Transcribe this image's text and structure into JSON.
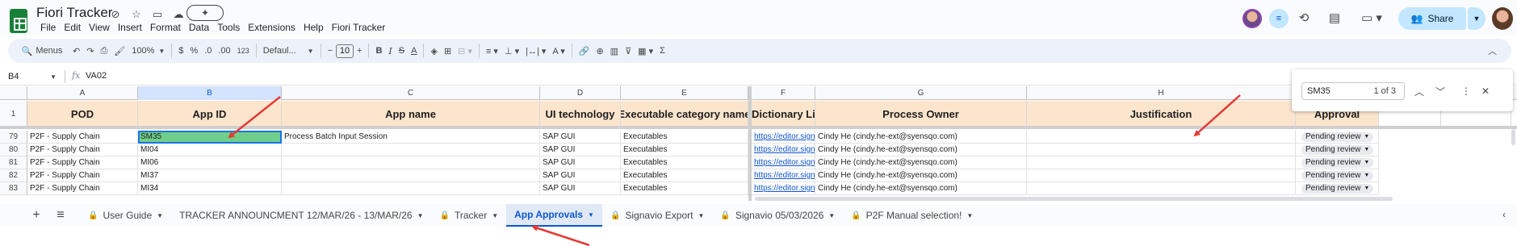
{
  "title_bar": {
    "doc_title": "Fiori Tracker",
    "menu": [
      "File",
      "Edit",
      "View",
      "Insert",
      "Format",
      "Data",
      "Tools",
      "Extensions",
      "Help",
      "Fiori Tracker"
    ],
    "share_label": "Share"
  },
  "toolbar": {
    "menus_label": "Menus",
    "zoom": "100%",
    "currency": "$",
    "percent": "%",
    "dec_decrease": ".0",
    "dec_increase": ".00",
    "number_format": "123",
    "font": "Defaul...",
    "font_size": "10"
  },
  "formula_bar": {
    "cell_ref": "B4",
    "fx": "fx",
    "value": "VA02"
  },
  "find": {
    "query": "SM35",
    "count": "1 of 3"
  },
  "grid": {
    "columns": [
      "A",
      "B",
      "C",
      "D",
      "E",
      "F",
      "G",
      "H",
      "I",
      "",
      ""
    ],
    "header_row_number": "1",
    "headers": [
      "POD",
      "App ID",
      "App name",
      "UI technology",
      "Executable category name",
      "Dictionary Link",
      "Process Owner",
      "Justification",
      "Approval"
    ],
    "rows": [
      {
        "num": "79",
        "pod": "P2F - Supply Chain",
        "app_id": "SM35",
        "app_name": "Process Batch Input Session",
        "ui": "SAP GUI",
        "category": "Executables",
        "link": "https://editor.signavio.com",
        "owner": "Cindy He (cindy.he-ext@syensqo.com)",
        "justification": "",
        "approval": "Pending review"
      },
      {
        "num": "80",
        "pod": "P2F - Supply Chain",
        "app_id": "MI04",
        "app_name": "",
        "ui": "SAP GUI",
        "category": "Executables",
        "link": "https://editor.signavio.com",
        "owner": "Cindy He (cindy.he-ext@syensqo.com)",
        "justification": "",
        "approval": "Pending review"
      },
      {
        "num": "81",
        "pod": "P2F - Supply Chain",
        "app_id": "MI06",
        "app_name": "",
        "ui": "SAP GUI",
        "category": "Executables",
        "link": "https://editor.signavio.com",
        "owner": "Cindy He (cindy.he-ext@syensqo.com)",
        "justification": "",
        "approval": "Pending review"
      },
      {
        "num": "82",
        "pod": "P2F - Supply Chain",
        "app_id": "MI37",
        "app_name": "",
        "ui": "SAP GUI",
        "category": "Executables",
        "link": "https://editor.signavio.com",
        "owner": "Cindy He (cindy.he-ext@syensqo.com)",
        "justification": "",
        "approval": "Pending review"
      },
      {
        "num": "83",
        "pod": "P2F - Supply Chain",
        "app_id": "MI34",
        "app_name": "",
        "ui": "SAP GUI",
        "category": "Executables",
        "link": "https://editor.signavio.com",
        "owner": "Cindy He (cindy.he-ext@syensqo.com)",
        "justification": "",
        "approval": "Pending review"
      }
    ]
  },
  "sheet_tabs": [
    {
      "label": "User Guide",
      "locked": true
    },
    {
      "label": "TRACKER ANNOUNCMENT 12/MAR/26 - 13/MAR/26",
      "locked": false
    },
    {
      "label": "Tracker",
      "locked": true
    },
    {
      "label": "App Approvals",
      "locked": false,
      "active": true
    },
    {
      "label": "Signavio Export",
      "locked": true
    },
    {
      "label": "Signavio 05/03/2026",
      "locked": true
    },
    {
      "label": "P2F Manual selection!",
      "locked": true
    }
  ],
  "colors": {
    "header_fill": "#fce5cd",
    "active_cell_fill": "#6fcf8a",
    "accent": "#0b57d0",
    "arrow": "#e53935"
  }
}
